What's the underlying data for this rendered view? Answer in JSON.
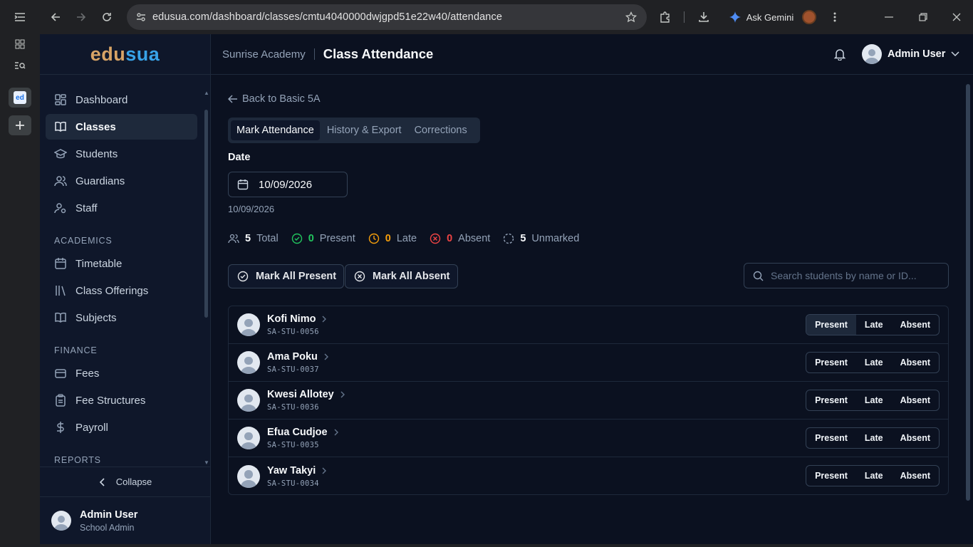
{
  "browser": {
    "url": "edusua.com/dashboard/classes/cmtu4040000dwjgpd51e22w40/attendance",
    "ask_gemini": "Ask Gemini"
  },
  "sidebar": {
    "logo_part1": "edu",
    "logo_part2": "sua",
    "items": [
      {
        "label": "Dashboard"
      },
      {
        "label": "Classes"
      },
      {
        "label": "Students"
      },
      {
        "label": "Guardians"
      },
      {
        "label": "Staff"
      }
    ],
    "academics_heading": "ACADEMICS",
    "academics": [
      {
        "label": "Timetable"
      },
      {
        "label": "Class Offerings"
      },
      {
        "label": "Subjects"
      }
    ],
    "finance_heading": "FINANCE",
    "finance": [
      {
        "label": "Fees"
      },
      {
        "label": "Fee Structures"
      },
      {
        "label": "Payroll"
      }
    ],
    "reports_heading": "REPORTS",
    "collapse_label": "Collapse",
    "user_name": "Admin User",
    "user_role": "School Admin"
  },
  "header": {
    "school": "Sunrise Academy",
    "title": "Class Attendance",
    "user": "Admin User"
  },
  "page": {
    "back_label": "Back to Basic 5A",
    "tabs": [
      {
        "label": "Mark Attendance"
      },
      {
        "label": "History & Export"
      },
      {
        "label": "Corrections"
      }
    ],
    "date_label": "Date",
    "date_value": "10/09/2026",
    "date_sub": "10/09/2026",
    "stats": {
      "total_count": "5",
      "total_label": "Total",
      "present_count": "0",
      "present_label": "Present",
      "late_count": "0",
      "late_label": "Late",
      "absent_count": "0",
      "absent_label": "Absent",
      "unmarked_count": "5",
      "unmarked_label": "Unmarked"
    },
    "mark_all_present": "Mark All Present",
    "mark_all_absent": "Mark All Absent",
    "search_placeholder": "Search students by name or ID...",
    "status_options": [
      "Present",
      "Late",
      "Absent"
    ],
    "students": [
      {
        "name": "Kofi Nimo",
        "id": "SA-STU-0056"
      },
      {
        "name": "Ama Poku",
        "id": "SA-STU-0037"
      },
      {
        "name": "Kwesi Allotey",
        "id": "SA-STU-0036"
      },
      {
        "name": "Efua Cudjoe",
        "id": "SA-STU-0035"
      },
      {
        "name": "Yaw Takyi",
        "id": "SA-STU-0034"
      }
    ]
  },
  "colors": {
    "present": "#22c55e",
    "late": "#f59e0b",
    "absent": "#ef4444",
    "logo_edu": "#d8a466",
    "logo_sua": "#38a3e8"
  }
}
